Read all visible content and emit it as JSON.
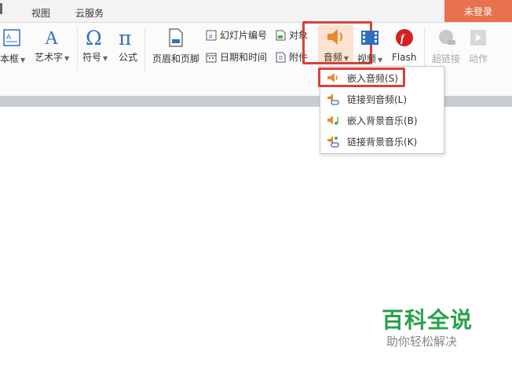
{
  "tabs": {
    "view": "视图",
    "cloud": "云服务",
    "login": "未登录"
  },
  "ribbon": {
    "textbox": "本框",
    "wordart": "艺术字",
    "symbol": "符号",
    "formula": "公式",
    "header_footer": "页眉和页脚",
    "slide_number": "幻灯片编号",
    "object": "对象",
    "datetime": "日期和时间",
    "attachment": "附件",
    "audio": "音频",
    "video": "视频",
    "flash": "Flash",
    "hyperlink": "超链接",
    "action": "动作"
  },
  "audio_menu": {
    "items": [
      "嵌入音频(S)",
      "链接到音频(L)",
      "嵌入背景音乐(B)",
      "链接背景音乐(K)"
    ]
  },
  "watermark": {
    "title": "百科全说",
    "subtitle": "助你轻松解决"
  },
  "colors": {
    "login_bg": "#e8714e",
    "highlight": "#d9403b",
    "watermark_green": "#29a14a",
    "accent_blue": "#2f6fbf",
    "flash_red": "#d6201f",
    "audio_orange": "#e88a2e"
  }
}
